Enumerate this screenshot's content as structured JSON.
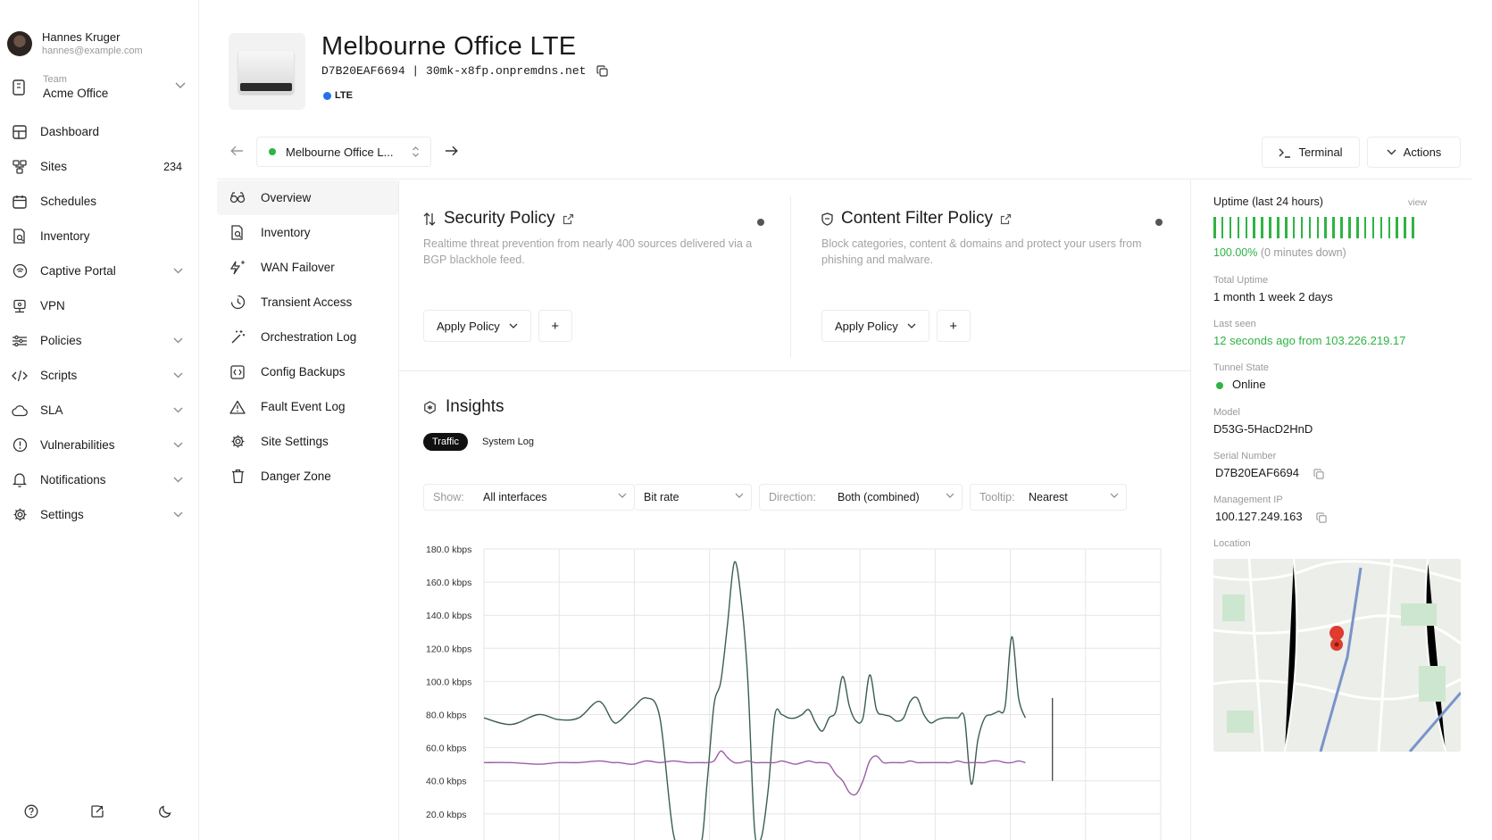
{
  "user": {
    "name": "Hannes Kruger",
    "email": "hannes@example.com"
  },
  "team": {
    "label": "Team",
    "name": "Acme Office"
  },
  "nav": [
    {
      "label": "Dashboard",
      "icon": "dashboard-icon"
    },
    {
      "label": "Sites",
      "icon": "sites-icon",
      "count": "234"
    },
    {
      "label": "Schedules",
      "icon": "calendar-icon"
    },
    {
      "label": "Inventory",
      "icon": "inventory-icon"
    },
    {
      "label": "Captive Portal",
      "icon": "portal-icon",
      "expandable": true
    },
    {
      "label": "VPN",
      "icon": "vpn-icon"
    },
    {
      "label": "Policies",
      "icon": "policies-icon",
      "expandable": true
    },
    {
      "label": "Scripts",
      "icon": "code-icon",
      "expandable": true
    },
    {
      "label": "SLA",
      "icon": "cloud-icon",
      "expandable": true
    },
    {
      "label": "Vulnerabilities",
      "icon": "alert-circle-icon",
      "expandable": true
    },
    {
      "label": "Notifications",
      "icon": "bell-icon",
      "expandable": true
    },
    {
      "label": "Settings",
      "icon": "gear-icon",
      "expandable": true
    }
  ],
  "device": {
    "title": "Melbourne Office LTE",
    "subtitle": "D7B20EAF6694 | 30mk-x8fp.onpremdns.net",
    "badge": "LTE",
    "badge_color": "#2273e6"
  },
  "toolbar": {
    "site_name": "Melbourne Office L...",
    "terminal_label": "Terminal",
    "actions_label": "Actions"
  },
  "subnav": [
    {
      "label": "Overview",
      "icon": "overview-icon",
      "active": true
    },
    {
      "label": "Inventory",
      "icon": "inventory-icon"
    },
    {
      "label": "WAN Failover",
      "icon": "wan-failover-icon"
    },
    {
      "label": "Transient Access",
      "icon": "clock-icon"
    },
    {
      "label": "Orchestration Log",
      "icon": "wand-icon"
    },
    {
      "label": "Config Backups",
      "icon": "backup-icon"
    },
    {
      "label": "Fault Event Log",
      "icon": "warning-icon"
    },
    {
      "label": "Site Settings",
      "icon": "gear-icon"
    },
    {
      "label": "Danger Zone",
      "icon": "trash-icon"
    }
  ],
  "security_policy": {
    "title": "Security Policy",
    "description": "Realtime threat prevention from nearly 400 sources delivered via a BGP blackhole feed.",
    "apply_label": "Apply Policy",
    "add_label": "+"
  },
  "content_policy": {
    "title": "Content Filter Policy",
    "description": "Block categories, content & domains and protect your users from phishing and malware.",
    "apply_label": "Apply Policy",
    "add_label": "+"
  },
  "insights": {
    "title": "Insights",
    "tabs": [
      "Traffic",
      "System Log"
    ],
    "active_tab": "Traffic",
    "filters": {
      "show_label": "Show:",
      "show_value": "All interfaces",
      "metric_value": "Bit rate",
      "direction_label": "Direction:",
      "direction_value": "Both (combined)",
      "tooltip_label": "Tooltip:",
      "tooltip_value": "Nearest"
    }
  },
  "chart_data": {
    "type": "line",
    "ylim": [
      0,
      180
    ],
    "y_unit": "kbps",
    "y_ticks": [
      "180.0 kbps",
      "160.0 kbps",
      "140.0 kbps",
      "120.0 kbps",
      "100.0 kbps",
      "80.0 kbps",
      "60.0 kbps",
      "40.0 kbps",
      "20.0 kbps"
    ],
    "x": [
      0,
      4,
      8,
      11,
      14,
      17,
      19,
      20,
      22,
      24,
      26,
      28,
      30,
      32,
      33,
      34,
      35,
      36,
      37,
      38,
      39,
      40,
      41,
      42,
      43,
      44,
      45,
      46,
      47,
      48,
      49,
      50,
      51,
      52,
      53,
      54,
      55,
      56,
      57,
      58,
      59,
      60,
      61,
      62,
      63,
      64,
      65,
      66,
      67,
      68,
      69,
      70,
      71,
      72,
      73,
      74,
      75,
      76,
      77,
      78,
      79,
      80,
      81,
      82,
      83,
      84,
      85,
      86,
      87,
      88,
      89,
      90,
      91,
      92,
      93,
      94,
      95,
      96,
      97,
      98,
      99,
      100
    ],
    "series": [
      {
        "color": "#3b5e4f",
        "values": [
          78,
          74,
          80,
          77,
          78,
          88,
          76,
          76,
          84,
          90,
          78,
          8,
          -5,
          0,
          40,
          86,
          100,
          135,
          172,
          150,
          100,
          10,
          6,
          35,
          80,
          80,
          78,
          78,
          80,
          83,
          75,
          70,
          78,
          82,
          103,
          85,
          76,
          78,
          104,
          83,
          80,
          79,
          76,
          78,
          88,
          90,
          80,
          75,
          77,
          78,
          78,
          78,
          78,
          38,
          65,
          78,
          80,
          82,
          85,
          127,
          90,
          78
        ]
      },
      {
        "color": "#9b5ca8",
        "values": [
          51,
          51,
          50,
          51,
          51,
          52,
          51,
          51,
          50,
          52,
          51,
          52,
          51,
          51,
          51,
          52,
          58,
          54,
          51,
          51,
          52,
          51,
          51,
          51,
          51,
          52,
          51,
          50,
          51,
          52,
          51,
          51,
          50,
          44,
          40,
          33,
          32,
          40,
          52,
          55,
          51,
          51,
          51,
          51,
          52,
          51,
          51,
          51,
          51,
          51,
          51,
          52,
          51,
          51,
          51,
          51,
          52,
          52,
          51,
          51,
          52,
          51
        ]
      }
    ]
  },
  "right_panel": {
    "uptime_title": "Uptime (last 24 hours)",
    "uptime_view": "view",
    "uptime_pct": "100.00%",
    "uptime_down": "(0 minutes down)",
    "uptime_bar_color": "#2fb344",
    "total_uptime_label": "Total Uptime",
    "total_uptime": "1 month 1 week 2 days",
    "last_seen_label": "Last seen",
    "last_seen": "12 seconds ago from 103.226.219.17",
    "tunnel_label": "Tunnel State",
    "tunnel_state": "Online",
    "model_label": "Model",
    "model": "D53G-5HacD2HnD",
    "serial_label": "Serial Number",
    "serial": "D7B20EAF6694",
    "mgmt_label": "Management IP",
    "mgmt_ip": "100.127.249.163",
    "location_label": "Location"
  }
}
